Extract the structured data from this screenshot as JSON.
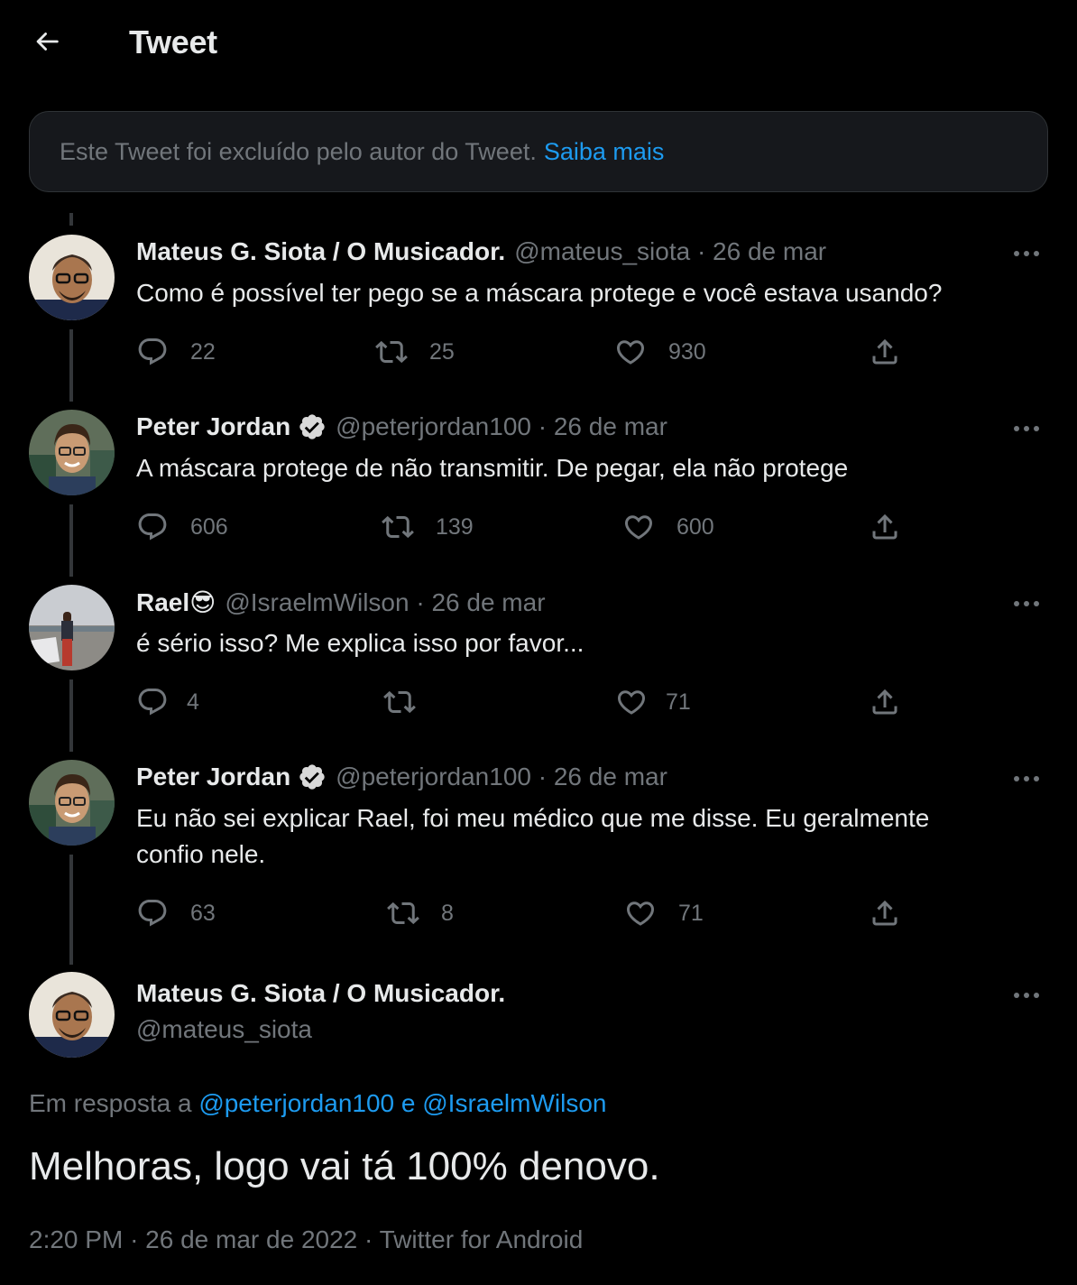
{
  "header": {
    "title": "Tweet"
  },
  "deleted_notice": {
    "text": "Este Tweet foi excluído pelo autor do Tweet.",
    "link": "Saiba mais"
  },
  "tweets": [
    {
      "name": "Mateus G. Siota / O Musicador.",
      "verified": false,
      "meta": "@mateus_siota · 26 de mar",
      "text": "Como é possível ter pego se a máscara protege e você estava usando?",
      "replies": "22",
      "retweets": "25",
      "likes": "930"
    },
    {
      "name": "Peter Jordan",
      "verified": true,
      "meta": "@peterjordan100 · 26 de mar",
      "text": "A máscara protege de não transmitir. De pegar, ela não protege",
      "replies": "606",
      "retweets": "139",
      "likes": "600"
    },
    {
      "name": "Rael😎",
      "verified": false,
      "meta": "@IsraelmWilson · 26 de mar",
      "text": "é sério isso? Me explica isso por favor...",
      "replies": "4",
      "retweets": "",
      "likes": "71"
    },
    {
      "name": "Peter Jordan",
      "verified": true,
      "meta": "@peterjordan100 · 26 de mar",
      "text": "Eu não sei explicar Rael, foi meu médico que me disse. Eu geralmente confio nele.",
      "replies": "63",
      "retweets": "8",
      "likes": "71"
    }
  ],
  "main_tweet": {
    "name": "Mateus G. Siota / O Musicador.",
    "handle": "@mateus_siota",
    "reply_prefix": "Em resposta a",
    "reply_user1": "@peterjordan100",
    "reply_and": "e",
    "reply_user2": "@IsraelmWilson",
    "text": "Melhoras, logo vai tá 100% denovo.",
    "time": "2:20 PM",
    "date": "26 de mar de 2022",
    "source": "Twitter for Android"
  },
  "colors": {
    "background": "#000000",
    "text": "#e7e9ea",
    "muted": "#71767b",
    "accent": "#1d9bf0",
    "line": "#333639"
  },
  "icons": [
    "back-arrow-icon",
    "more-icon",
    "reply-icon",
    "retweet-icon",
    "like-icon",
    "share-icon",
    "verified-badge-icon"
  ]
}
